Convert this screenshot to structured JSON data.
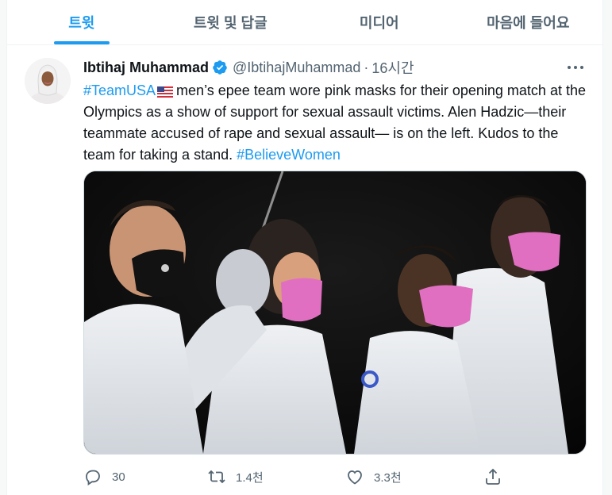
{
  "tabs": [
    {
      "label": "트윗"
    },
    {
      "label": "트윗 및 답글"
    },
    {
      "label": "미디어"
    },
    {
      "label": "마음에 들어요"
    }
  ],
  "tweet": {
    "author_name": "Ibtihaj Muhammad",
    "handle": "@IbtihajMuhammad",
    "separator": "·",
    "time": "16시간",
    "hashtag1": "#TeamUSA",
    "body_part1": "men’s epee team wore pink masks for their opening match at the Olympics as a show of support for sexual assault victims. Alen Hadzic—their teammate accused of rape and sexual assault— is on the left. Kudos to the team for taking a stand.",
    "hashtag2": "#BelieveWomen",
    "flag_icon": "us-flag-emoji"
  },
  "actions": {
    "reply_count": "30",
    "retweet_count": "1.4천",
    "like_count": "3.3천"
  },
  "colors": {
    "accent": "#1d9bf0",
    "secondary_text": "#536471",
    "mask_pink": "#e16fc1"
  }
}
